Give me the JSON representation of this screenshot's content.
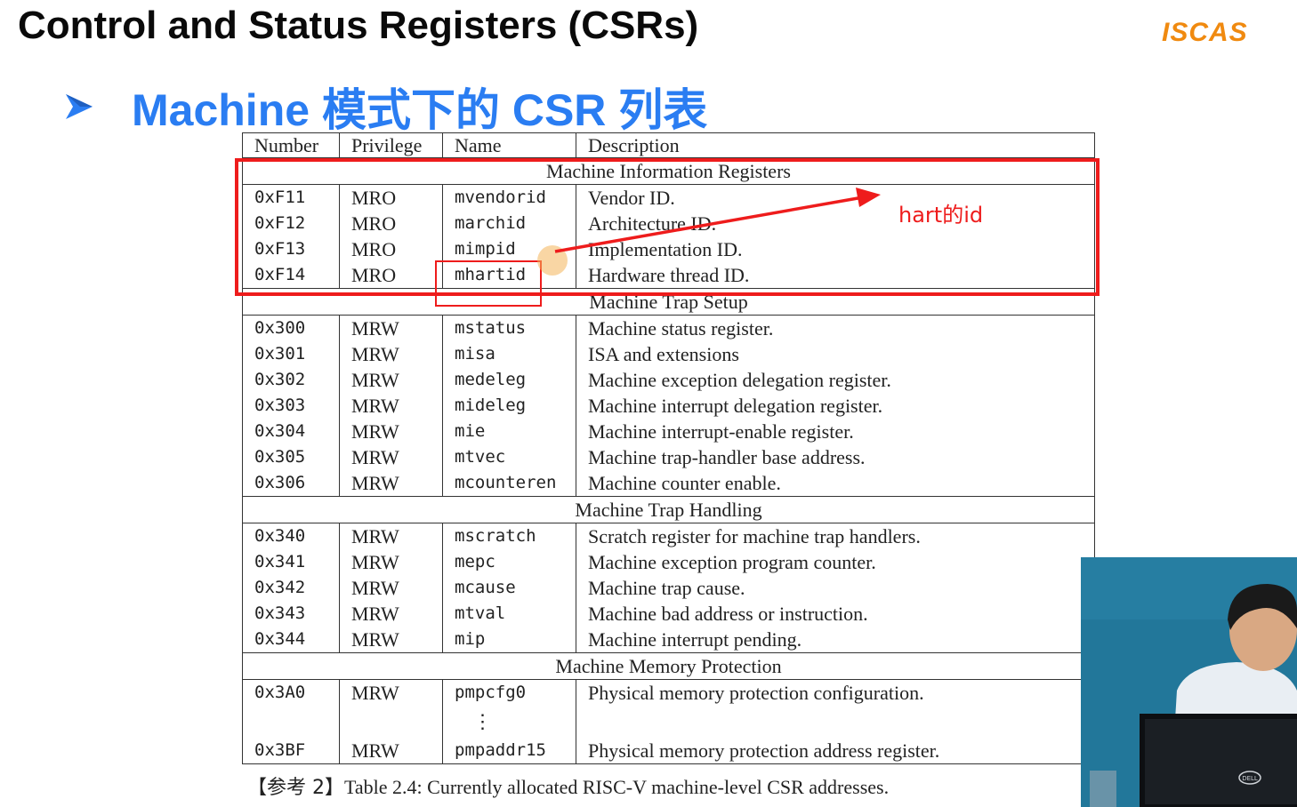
{
  "slide": {
    "title": "Control and Status Registers (CSRs)",
    "logo_text": "ISCAS",
    "subtitle": "Machine 模式下的 CSR 列表"
  },
  "table": {
    "headers": [
      "Number",
      "Privilege",
      "Name",
      "Description"
    ],
    "sections": [
      {
        "title": "Machine Information Registers",
        "rows": [
          {
            "number": "0xF11",
            "privilege": "MRO",
            "name": "mvendorid",
            "description": "Vendor ID."
          },
          {
            "number": "0xF12",
            "privilege": "MRO",
            "name": "marchid",
            "description": "Architecture ID."
          },
          {
            "number": "0xF13",
            "privilege": "MRO",
            "name": "mimpid",
            "description": "Implementation ID."
          },
          {
            "number": "0xF14",
            "privilege": "MRO",
            "name": "mhartid",
            "description": "Hardware thread ID."
          }
        ]
      },
      {
        "title": "Machine Trap Setup",
        "rows": [
          {
            "number": "0x300",
            "privilege": "MRW",
            "name": "mstatus",
            "description": "Machine status register."
          },
          {
            "number": "0x301",
            "privilege": "MRW",
            "name": "misa",
            "description": "ISA and extensions"
          },
          {
            "number": "0x302",
            "privilege": "MRW",
            "name": "medeleg",
            "description": "Machine exception delegation register."
          },
          {
            "number": "0x303",
            "privilege": "MRW",
            "name": "mideleg",
            "description": "Machine interrupt delegation register."
          },
          {
            "number": "0x304",
            "privilege": "MRW",
            "name": "mie",
            "description": "Machine interrupt-enable register."
          },
          {
            "number": "0x305",
            "privilege": "MRW",
            "name": "mtvec",
            "description": "Machine trap-handler base address."
          },
          {
            "number": "0x306",
            "privilege": "MRW",
            "name": "mcounteren",
            "description": "Machine counter enable."
          }
        ]
      },
      {
        "title": "Machine Trap Handling",
        "rows": [
          {
            "number": "0x340",
            "privilege": "MRW",
            "name": "mscratch",
            "description": "Scratch register for machine trap handlers."
          },
          {
            "number": "0x341",
            "privilege": "MRW",
            "name": "mepc",
            "description": "Machine exception program counter."
          },
          {
            "number": "0x342",
            "privilege": "MRW",
            "name": "mcause",
            "description": "Machine trap cause."
          },
          {
            "number": "0x343",
            "privilege": "MRW",
            "name": "mtval",
            "description": "Machine bad address or instruction."
          },
          {
            "number": "0x344",
            "privilege": "MRW",
            "name": "mip",
            "description": "Machine interrupt pending."
          }
        ]
      },
      {
        "title": "Machine Memory Protection",
        "rows": [
          {
            "number": "0x3A0",
            "privilege": "MRW",
            "name": "pmpcfg0",
            "description": "Physical memory protection configuration."
          },
          {
            "number": "0x3BF",
            "privilege": "MRW",
            "name": "pmpaddr15",
            "description": "Physical memory protection address register."
          }
        ],
        "ellipsis": "⋮"
      }
    ]
  },
  "caption": {
    "ref": "【参考 2】",
    "text": "Table 2.4: Currently allocated RISC-V machine-level CSR addresses."
  },
  "annotation": {
    "label": "hart的id",
    "color": "#ee1c1c"
  },
  "colors": {
    "subtitle": "#2a7df2",
    "highlight": "#ee1c1c",
    "logo": "#f08a10"
  },
  "icons": [
    "bullet-arrow-icon",
    "annotation-arrow-icon",
    "monitor-dell-icon"
  ]
}
